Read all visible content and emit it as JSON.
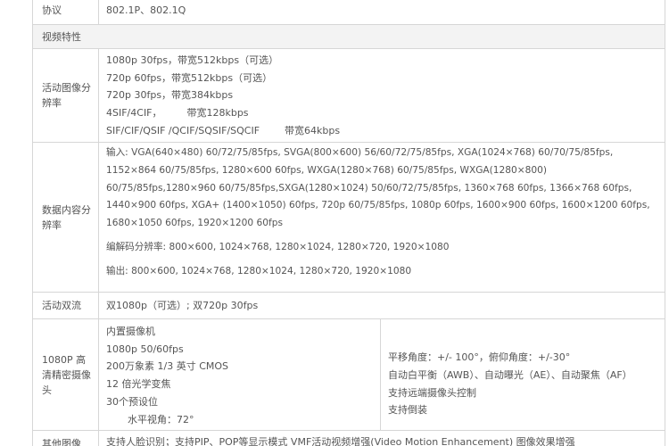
{
  "rows": {
    "protocol": {
      "label": "协议",
      "value": "802.1P、802.1Q"
    },
    "video_section": "视频特性",
    "motion_res": {
      "label": "活动图像分辨率",
      "lines": [
        "1080p 30fps，带宽512kbps（可选）",
        "720p 60fps，带宽512kbps（可选）",
        "720p 30fps，带宽384kbps",
        "4SIF/4CIF，        带宽128kbps",
        "SIF/CIF/QSIF /QCIF/SQSIF/SQCIF        带宽64kbps"
      ]
    },
    "data_res": {
      "label": "数据内容分辨率",
      "input": "输入: VGA(640×480) 60/72/75/85fps, SVGA(800×600) 56/60/72/75/85fps, XGA(1024×768) 60/70/75/85fps, 1152×864 60/75/85fps, 1280×600 60fps, WXGA(1280×768) 60/75/85fps, WXGA(1280×800) 60/75/85fps,1280×960 60/75/85fps,SXGA(1280×1024) 50/60/72/75/85fps, 1360×768 60fps, 1366×768 60fps, 1440×900 60fps, XGA+ (1400×1050) 60fps, 720p 60/75/85fps, 1080p 60fps, 1600×900 60fps, 1600×1200 60fps, 1680×1050 60fps, 1920×1200 60fps",
      "codec": "编解码分辨率: 800×600, 1024×768, 1280×1024, 1280×720, 1920×1080",
      "output": "输出: 800×600, 1024×768, 1280×1024, 1280×720, 1920×1080"
    },
    "dual_stream": {
      "label": "活动双流",
      "value": "双1080p（可选）; 双720p 30fps"
    },
    "camera": {
      "label": "1080P 高清精密摄像头",
      "left": [
        "内置摄像机",
        "1080p 50/60fps",
        "200万象素 1/3 英寸 CMOS",
        "12 倍光学变焦",
        "30个预设位"
      ],
      "left_indent": "水平视角：72°",
      "right": [
        "平移角度：+/- 100°，俯仰角度：+/-30°",
        "自动白平衡（AWB）、自动曝光（AE）、自动聚焦（AF）",
        "支持远端摄像头控制",
        "支持倒装"
      ]
    },
    "other": {
      "label": "其他图像",
      "value": "支持人脸识别；支持PIP、POP等显示模式 VMF活动视频增强(Video Motion Enhancement) 图像效果增强"
    }
  }
}
